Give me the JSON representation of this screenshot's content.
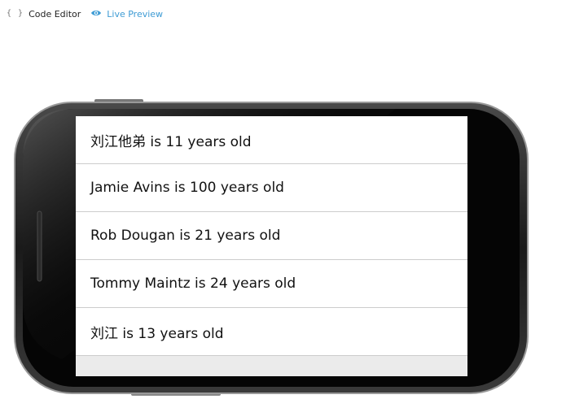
{
  "toolbar": {
    "code_editor": {
      "icon": "braces-icon",
      "glyph": "{ }",
      "label": "Code Editor"
    },
    "live_preview": {
      "icon": "eye-icon",
      "label": "Live Preview",
      "accent": "#3d9bd4"
    }
  },
  "list": {
    "items": [
      {
        "label": "刘江他弟 is 11 years old"
      },
      {
        "label": "Jamie Avins is 100 years old"
      },
      {
        "label": "Rob Dougan is 21 years old"
      },
      {
        "label": "Tommy Maintz is 24 years old"
      },
      {
        "label": "刘江 is 13 years old"
      }
    ]
  }
}
